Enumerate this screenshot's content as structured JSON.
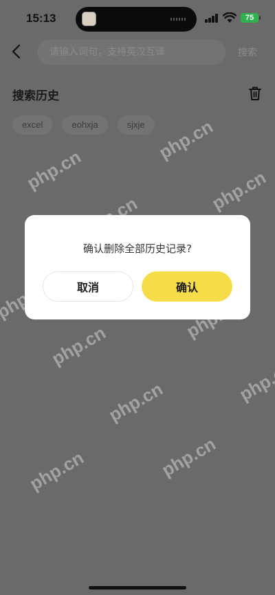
{
  "status_bar": {
    "time": "15:13",
    "battery": "75"
  },
  "header": {
    "search_placeholder": "请输入词句，支持英汉互译",
    "search_button": "搜索"
  },
  "history": {
    "title": "搜索历史",
    "items": [
      "excel",
      "eohxja",
      "sjxje"
    ]
  },
  "dialog": {
    "message": "确认删除全部历史记录?",
    "cancel_label": "取消",
    "confirm_label": "确认"
  },
  "watermark": "php.cn",
  "colors": {
    "overlay": "#6a6a6a",
    "confirm": "#f7dc4a",
    "battery": "#2fb24e"
  }
}
